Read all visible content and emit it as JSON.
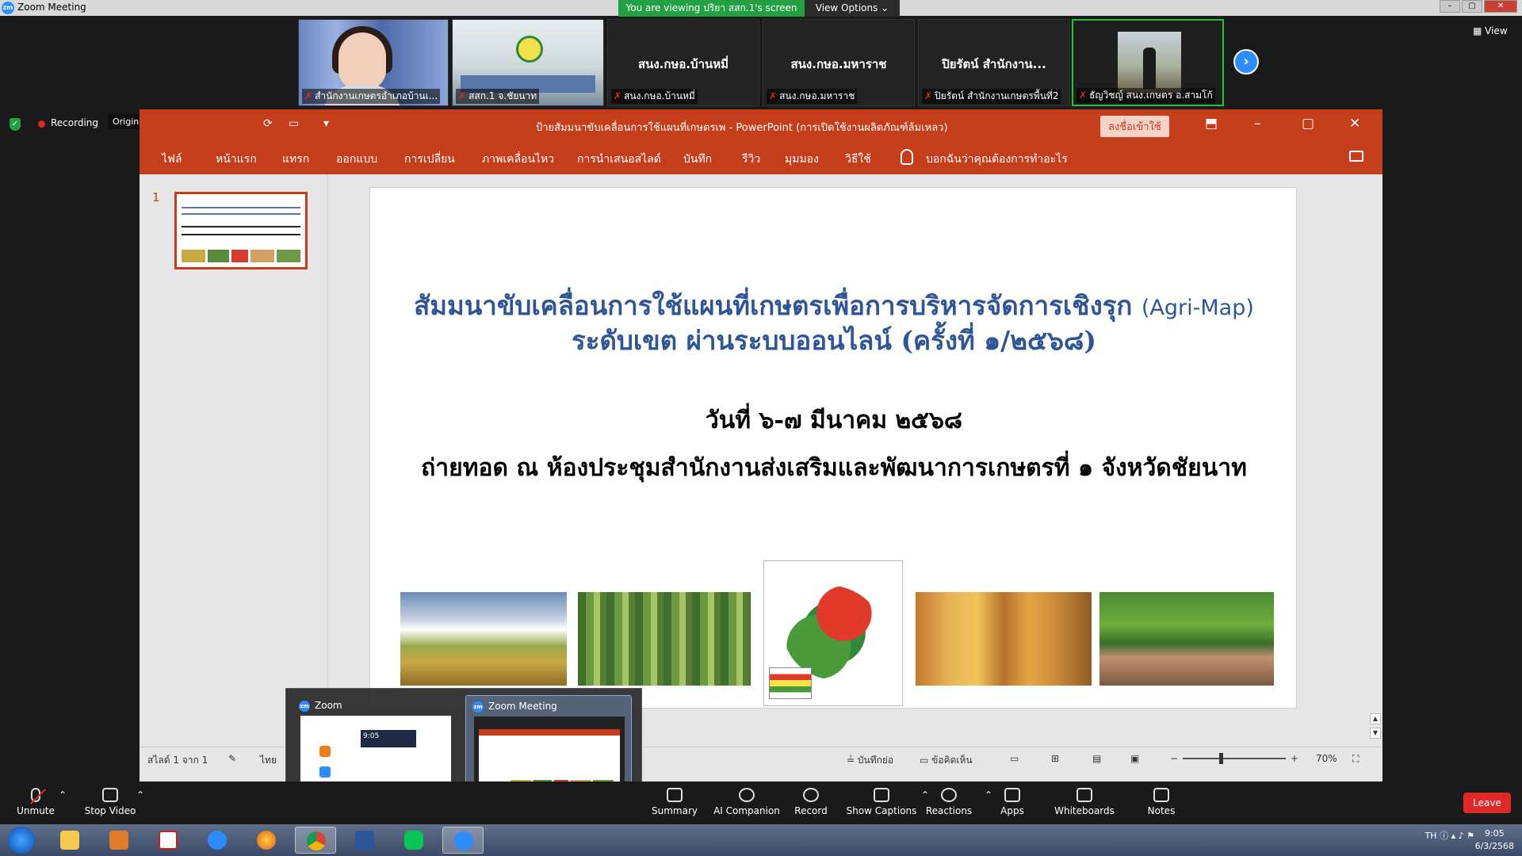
{
  "window": {
    "title": "Zoom Meeting",
    "logo": "zm",
    "controls": [
      "minimize-icon",
      "restore-icon",
      "close-icon"
    ]
  },
  "banner": {
    "viewing": "You are viewing ปริยา สสก.1's screen",
    "view_options": "View Options ⌄"
  },
  "participants": [
    {
      "name": "สำนักงานเกษตรอำเภอบ้านเ...",
      "center": ""
    },
    {
      "name": "สสก.1 จ.ชัยนาท",
      "center": ""
    },
    {
      "name": "สนง.กษอ.บ้านหมี่",
      "center": "สนง.กษอ.บ้านหมี่"
    },
    {
      "name": "สนง.กษอ.มหาราช",
      "center": "สนง.กษอ.มหาราช"
    },
    {
      "name": "ปิยรัตน์ สำนักงานเกษตรพื้นที่2",
      "center": "ปิยรัตน์ สำนักงาน..."
    },
    {
      "name": "ธัญวิชญ์ สนง.เกษตร อ.สามโก้",
      "center": ""
    }
  ],
  "view_label": "▦ View",
  "next_arrow": "›",
  "recording": {
    "label": "Recording",
    "original_sound": "Original Sound for Musicians: Off"
  },
  "ppt": {
    "doc_title": "ป้ายสัมมนาขับเคลื่อนการใช้แผนที่เกษตรเพ  -  PowerPoint (การเปิดใช้งานผลิตภัณฑ์ล้มเหลว)",
    "signin": "ลงชื่อเข้าใช้",
    "ribbon_tabs": [
      "ไฟล์",
      "หน้าแรก",
      "แทรก",
      "ออกแบบ",
      "การเปลี่ยน",
      "ภาพเคลื่อนไหว",
      "การนำเสนอสไลด์",
      "บันทึก",
      "รีวิว",
      "มุมมอง",
      "วิธีใช้"
    ],
    "tell_me": "บอกฉันว่าคุณต้องการทำอะไร",
    "thumb_number": "1",
    "slide": {
      "title_line1": "สัมมนาขับเคลื่อนการใช้แผนที่เกษตรเพื่อการบริหารจัดการเชิงรุก",
      "title_en": "(Agri-Map)",
      "title_line2": "ระดับเขต ผ่านระบบออนไลน์ (ครั้งที่ ๑/๒๕๖๘)",
      "date": "วันที่ ๖-๗ มีนาคม ๒๕๖๘",
      "venue": "ถ่ายทอด ณ ห้องประชุมสำนักงานส่งเสริมและพัฒนาการเกษตรที่ ๑ จังหวัดชัยนาท"
    },
    "status": {
      "slide_of": "สไลด์ 1 จาก 1",
      "lang": "ไทย",
      "notes": "บันทึกย่อ",
      "comments": "ข้อคิดเห็น",
      "zoom_minus": "−",
      "zoom_plus": "+",
      "zoom": "70%"
    }
  },
  "switcher": {
    "items": [
      "Zoom",
      "Zoom Meeting"
    ],
    "active": 1,
    "preview_time": "9:05"
  },
  "toolbar": {
    "unmute": "Unmute",
    "stop_video": "Stop Video",
    "summary": "Summary",
    "ai_companion": "AI Companion",
    "record": "Record",
    "show_captions": "Show Captions",
    "reactions": "Reactions",
    "apps": "Apps",
    "whiteboards": "Whiteboards",
    "notes": "Notes",
    "leave": "Leave"
  },
  "taskbar": {
    "apps": [
      "file-explorer-icon",
      "media-player-icon",
      "pdf-reader-icon",
      "internet-explorer-icon",
      "firefox-icon",
      "chrome-icon",
      "word-icon",
      "line-icon",
      "zoom-icon"
    ],
    "lang": "TH",
    "time": "9:05",
    "date": "6/3/2568"
  },
  "colors": {
    "ppt_red": "#c43e1c",
    "zoom_blue": "#2d8cff",
    "green": "#23a142",
    "leave_red": "#e02828",
    "slide_title_blue": "#2f5597"
  }
}
